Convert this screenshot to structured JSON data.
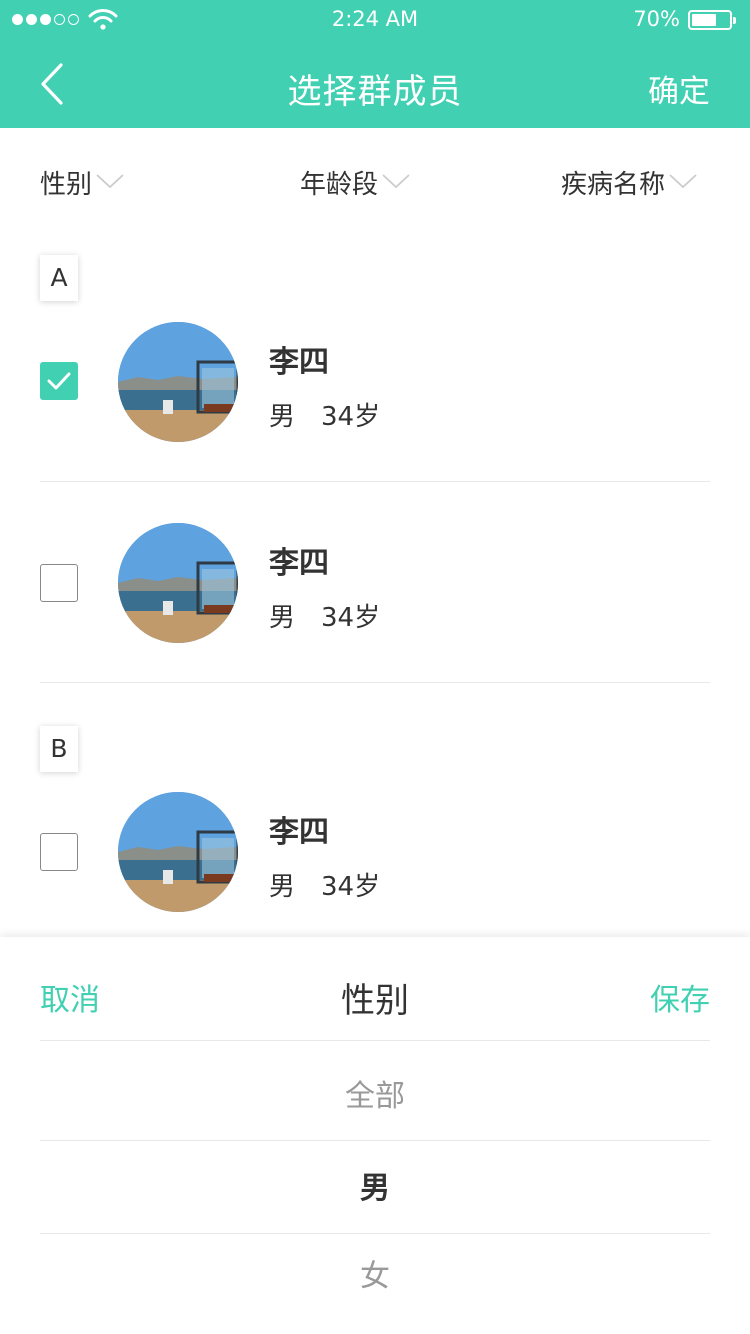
{
  "status": {
    "time": "2:24 AM",
    "battery_pct": "70%",
    "battery_level": 0.7,
    "signal_bars_filled": 3,
    "signal_bars_total": 5
  },
  "navbar": {
    "back_icon": "chevron-left-icon",
    "title": "选择群成员",
    "confirm": "确定"
  },
  "filters": [
    {
      "label": "性别"
    },
    {
      "label": "年龄段"
    },
    {
      "label": "疾病名称"
    }
  ],
  "sections": [
    {
      "letter": "A",
      "members": [
        {
          "name": "李四",
          "gender": "男",
          "age": "34岁",
          "checked": true
        },
        {
          "name": "李四",
          "gender": "男",
          "age": "34岁",
          "checked": false
        }
      ]
    },
    {
      "letter": "B",
      "members": [
        {
          "name": "李四",
          "gender": "男",
          "age": "34岁",
          "checked": false
        }
      ]
    }
  ],
  "sheet": {
    "cancel": "取消",
    "title": "性别",
    "save": "保存",
    "options": [
      "全部",
      "男",
      "女"
    ],
    "selected": "男"
  },
  "colors": {
    "accent": "#41d0b2",
    "text": "#333333",
    "muted": "#999999"
  }
}
